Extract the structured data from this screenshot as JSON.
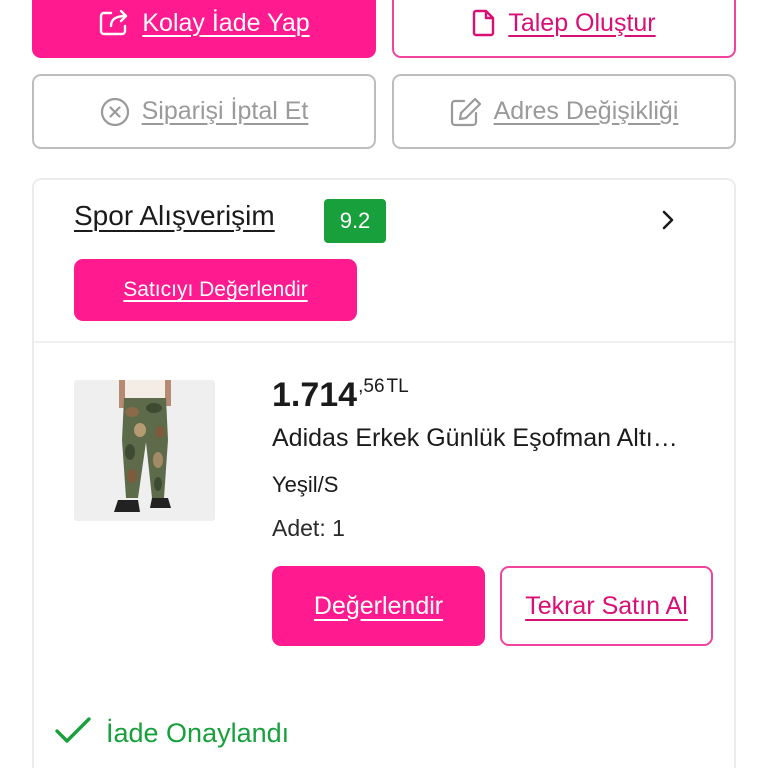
{
  "actions": {
    "easy_return": {
      "label": "Kolay İade Yap",
      "icon": "return-arrow-icon"
    },
    "create_request": {
      "label": "Talep Oluştur",
      "icon": "document-icon"
    },
    "cancel_order": {
      "label": "Siparişi İptal Et",
      "icon": "cancel-circle-icon"
    },
    "address_change": {
      "label": "Adres Değişikliği",
      "icon": "edit-icon"
    }
  },
  "seller": {
    "name": "Spor Alışverişim",
    "score": "9.2",
    "rate_button_label": "Satıcıyı Değerlendir"
  },
  "product": {
    "price_main": "1.714",
    "price_decimal": ",56",
    "currency": "TL",
    "name": "Adidas Erkek Günlük Eşofman Altı…",
    "variant": "Yeşil/S",
    "quantity": "Adet: 1",
    "rate_label": "Değerlendir",
    "rebuy_label": "Tekrar Satın Al"
  },
  "status": {
    "text": "İade Onaylandı",
    "icon": "checkmark-icon"
  },
  "colors": {
    "brand_pink": "#ff1a8f",
    "pink_outline": "#f0449d",
    "success_green": "#18a03c",
    "disabled_gray": "#9a9a9a"
  }
}
